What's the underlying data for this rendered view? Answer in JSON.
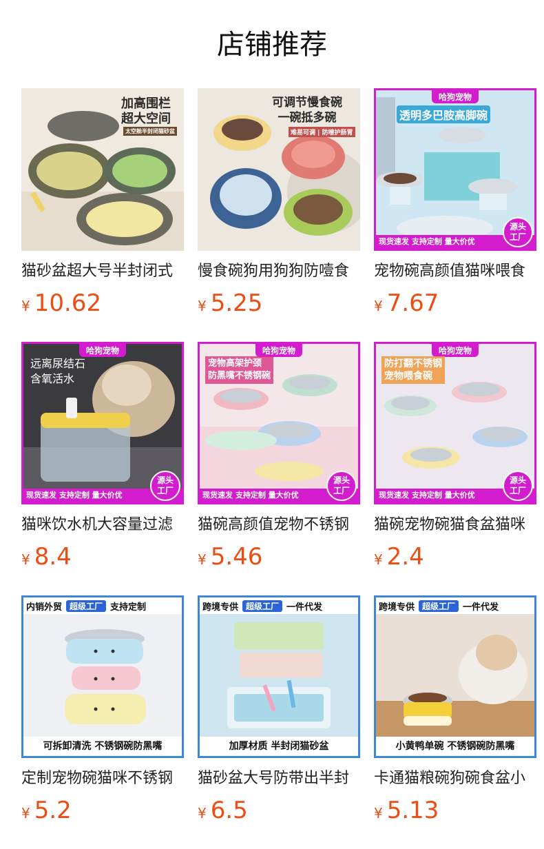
{
  "page": {
    "title": "店铺推荐"
  },
  "products": [
    {
      "name": "猫砂盆超大号半封闭式",
      "currency": "¥",
      "price": "10.62",
      "image": {
        "headline": "加高围栏\n超大空间",
        "sub": "太空舱半封闭猫砂盆"
      }
    },
    {
      "name": "慢食碗狗用狗狗防噎食",
      "currency": "¥",
      "price": "5.25",
      "image": {
        "headline": "可调节慢食碗\n一碗抵多碗",
        "sub": "难易可调 | 防噎护肠胃"
      }
    },
    {
      "name": "宠物碗高颜值猫咪喂食",
      "currency": "¥",
      "price": "7.67",
      "image": {
        "brand": "哈狗宠物",
        "headline": "透明多巴胺高脚碗",
        "bar": "现货速发 支持定制 量大价优",
        "badge": "源头\n工厂"
      }
    },
    {
      "name": "猫咪饮水机大容量过滤",
      "currency": "¥",
      "price": "8.4",
      "image": {
        "brand": "哈狗宠物",
        "headline": "远离尿结石\n含氧活水",
        "bar": "现货速发 支持定制 量大价优",
        "badge": "源头\n工厂"
      }
    },
    {
      "name": "猫碗高颜值宠物不锈钢",
      "currency": "¥",
      "price": "5.46",
      "image": {
        "brand": "哈狗宠物",
        "headline": "宠物高架护颈\n防黑嘴不锈钢碗",
        "bar": "现货速发 支持定制 量大价优",
        "badge": "源头\n工厂"
      }
    },
    {
      "name": "猫碗宠物碗猫食盆猫咪",
      "currency": "¥",
      "price": "2.4",
      "image": {
        "brand": "哈狗宠物",
        "headline": "防打翻不锈钢\n宠物喂食碗",
        "bar": "现货速发 支持定制 量大价优",
        "badge": "源头\n工厂"
      }
    },
    {
      "name": "定制宠物碗猫咪不锈钢",
      "currency": "¥",
      "price": "5.2",
      "image": {
        "tag1": "内销外贸",
        "tag2": "超级工厂",
        "tag3": "支持定制",
        "footer": "可拆卸清洗 不锈钢碗防黑嘴"
      }
    },
    {
      "name": "猫砂盆大号防带出半封",
      "currency": "¥",
      "price": "6.5",
      "image": {
        "tag1": "跨境专供",
        "tag2": "超级工厂",
        "tag3": "一件代发",
        "footer": "加厚材质 半封闭猫砂盆"
      }
    },
    {
      "name": "卡通猫粮碗狗碗食盆小",
      "currency": "¥",
      "price": "5.13",
      "image": {
        "tag1": "跨境专供",
        "tag2": "超级工厂",
        "tag3": "一件代发",
        "footer": "小黄鸭单碗 不锈钢碗防黑嘴"
      }
    }
  ],
  "colors": {
    "price": "#ee4c12",
    "frame_magenta": "#d41ccf",
    "frame_blue": "#3a86d8"
  }
}
